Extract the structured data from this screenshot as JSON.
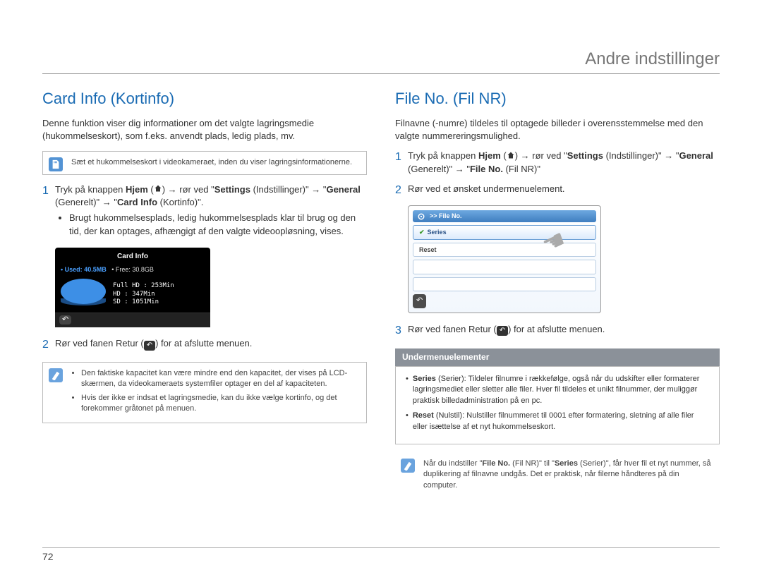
{
  "header": {
    "title": "Andre indstillinger"
  },
  "pageNumber": "72",
  "left": {
    "heading": "Card Info (Kortinfo)",
    "intro": "Denne funktion viser dig informationer om det valgte lagringsmedie (hukommelseskort), som f.eks. anvendt plads, ledig plads, mv.",
    "insertNote": "Sæt et hukommelseskort i videokameraet, inden du viser lagringsinformationerne.",
    "step1_pre": "Tryk på knappen ",
    "step1_hjem": "Hjem",
    "step1_mid1": " → rør ved \"",
    "step1_settings": "Settings",
    "step1_mid2": " (Indstillinger)\" → \"",
    "step1_general": "General",
    "step1_mid3": " (Generelt)\" → \"",
    "step1_cardinfo": "Card Info",
    "step1_end": " (Kortinfo)\".",
    "step1_bullet": "Brugt hukommelsesplads, ledig hukommelsesplads klar til brug og den tid, der kan optages, afhængigt af den valgte videoopløsning, vises.",
    "screen": {
      "title": "Card Info",
      "used_label": "Used:",
      "used_value": "40.5MB",
      "free_label": "Free:",
      "free_value": "30.8GB",
      "row1": "Full HD : 253Min",
      "row2": "HD      : 347Min",
      "row3": "SD      : 1051Min"
    },
    "step2_pre": "Rør ved fanen Retur (",
    "step2_post": ") for at afslutte menuen.",
    "note_b1": "Den faktiske kapacitet kan være mindre end den kapacitet, der vises på LCD-skærmen, da videokameraets systemfiler optager en del af kapaciteten.",
    "note_b2": "Hvis der ikke er indsat et lagringsmedie, kan du ikke vælge kortinfo, og det forekommer gråtonet på menuen."
  },
  "right": {
    "heading": "File No. (Fil NR)",
    "intro": "Filnavne (-numre) tildeles til optagede billeder i overensstemmelse med den valgte nummereringsmulighed.",
    "step1_pre": "Tryk på knappen ",
    "step1_hjem": "Hjem",
    "step1_mid1": " → rør ved \"",
    "step1_settings": "Settings",
    "step1_mid2": " (Indstillinger)\" → \"",
    "step1_general": "General",
    "step1_mid3": " (Generelt)\" → \"",
    "step1_fileno": "File No.",
    "step1_end": " (Fil NR)\"",
    "step2": "Rør ved et ønsket undermenuelement.",
    "screen": {
      "path": ">> File No.",
      "opt1": "Series",
      "opt2": "Reset"
    },
    "step3_pre": "Rør ved fanen Retur (",
    "step3_post": ") for at afslutte menuen.",
    "subheader": "Undermenuelementer",
    "def_series_label": "Series",
    "def_series_paren": "(Serier): ",
    "def_series_text": "Tildeler filnumre i rækkefølge, også når du udskifter eller formaterer lagringsmediet eller sletter alle filer. Hver fil tildeles et unikt filnummer, der muliggør praktisk billedadministration på en pc.",
    "def_reset_label": "Reset",
    "def_reset_paren": "(Nulstil): ",
    "def_reset_text": "Nulstiller filnummeret til 0001 efter formatering, sletning af alle filer eller isættelse af et nyt hukommelseskort.",
    "final_note_pre": "Når du indstiller \"",
    "final_note_b1": "File No.",
    "final_note_mid1": " (Fil NR)\" til \"",
    "final_note_b2": "Series",
    "final_note_mid2": " (Serier)\", får hver fil et nyt nummer, så duplikering af filnavne undgås. Det er praktisk, når filerne håndteres på din computer."
  }
}
